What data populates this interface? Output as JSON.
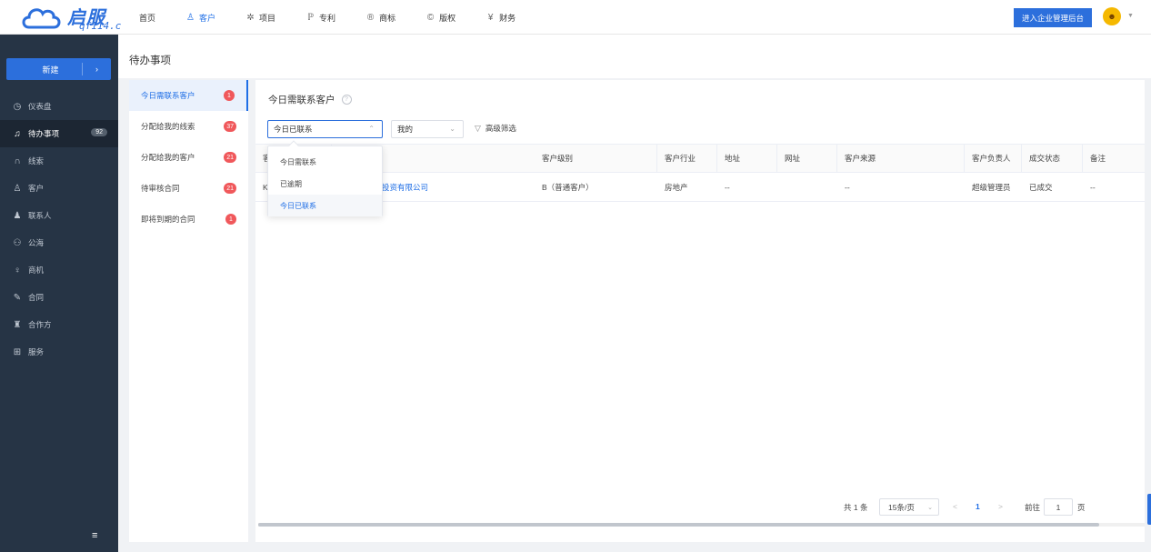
{
  "brand": {
    "name": "启服",
    "domain": "qf114.c",
    "color": "#2c6fdc"
  },
  "nav": [
    {
      "label": "首页",
      "icon": "",
      "active": false
    },
    {
      "label": "客户",
      "icon": "user-group-icon",
      "active": true
    },
    {
      "label": "项目",
      "icon": "project-icon",
      "active": false
    },
    {
      "label": "专利",
      "icon": "patent-icon",
      "active": false
    },
    {
      "label": "商标",
      "icon": "trademark-icon",
      "active": false
    },
    {
      "label": "版权",
      "icon": "copyright-icon",
      "active": false
    },
    {
      "label": "财务",
      "icon": "finance-icon",
      "active": false
    }
  ],
  "header": {
    "enter_admin": "进入企业管理后台"
  },
  "sidebar": {
    "new_label": "新建",
    "items": [
      {
        "label": "仪表盘",
        "icon": "dashboard-icon",
        "badge": ""
      },
      {
        "label": "待办事项",
        "icon": "bell-icon",
        "badge": "92",
        "active": true
      },
      {
        "label": "线索",
        "icon": "clue-icon",
        "badge": ""
      },
      {
        "label": "客户",
        "icon": "customer-icon",
        "badge": ""
      },
      {
        "label": "联系人",
        "icon": "contact-icon",
        "badge": ""
      },
      {
        "label": "公海",
        "icon": "pool-icon",
        "badge": ""
      },
      {
        "label": "商机",
        "icon": "opportunity-icon",
        "badge": ""
      },
      {
        "label": "合同",
        "icon": "contract-icon",
        "badge": ""
      },
      {
        "label": "合作方",
        "icon": "partner-icon",
        "badge": ""
      },
      {
        "label": "服务",
        "icon": "service-icon",
        "badge": ""
      }
    ]
  },
  "page": {
    "title": "待办事项"
  },
  "todo": [
    {
      "label": "今日需联系客户",
      "count": "1",
      "active": true
    },
    {
      "label": "分配给我的线索",
      "count": "37"
    },
    {
      "label": "分配给我的客户",
      "count": "21"
    },
    {
      "label": "待审核合同",
      "count": "21"
    },
    {
      "label": "即将到期的合同",
      "count": "1"
    }
  ],
  "panel": {
    "title": "今日需联系客户",
    "status_select": "今日已联系",
    "owner_select": "我的",
    "filter_label": "高级筛选",
    "dropdown_options": [
      "今日需联系",
      "已逾期",
      "今日已联系"
    ],
    "dropdown_selected": 2
  },
  "table": {
    "columns": [
      "客",
      "客户名称",
      "客户级别",
      "客户行业",
      "地址",
      "网址",
      "客户来源",
      "客户负责人",
      "成交状态",
      "备注"
    ],
    "rows": [
      [
        "K",
        "投资有限公司",
        "B（普通客户）",
        "房地产",
        "--",
        "",
        "--",
        "超级管理员",
        "已成交",
        "--"
      ]
    ]
  },
  "pagination": {
    "total": "共 1 条",
    "page_size": "15条/页",
    "prev": "<",
    "current": "1",
    "next": ">",
    "goto_label": "前往",
    "goto_value": "1",
    "page_suffix": "页"
  }
}
